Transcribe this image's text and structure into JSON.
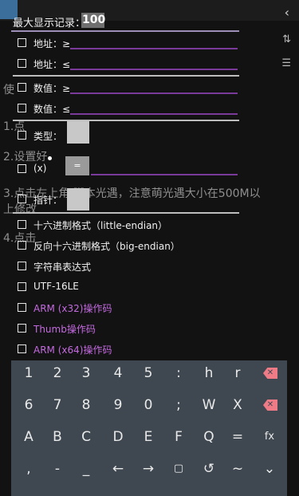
{
  "background": {
    "lines": [
      "使",
      "1.点",
      "2.设置好",
      "3.点击左上角 脚本光遇，注意萌光遇大小在500M以",
      "上修改",
      "4.点击 "
    ],
    "back_glyph": "‹",
    "side_glyphs": [
      "⇅",
      "☰"
    ]
  },
  "dialog": {
    "max_records_label": "最大显示记录：",
    "max_records_value": "100",
    "rows": [
      {
        "label": "地址：≥"
      },
      {
        "label": "地址：≤"
      },
      {
        "label": "数值：≥"
      },
      {
        "label": "数值：≤"
      },
      {
        "label": "类型："
      },
      {
        "label": "(x)"
      },
      {
        "label": "指针："
      },
      {
        "label": "十六进制格式（little-endian）"
      },
      {
        "label": "反向十六进制格式（big-endian）"
      },
      {
        "label": "字符串表达式"
      },
      {
        "label": "UTF-16LE"
      },
      {
        "label": "ARM (x32)操作码"
      },
      {
        "label": "Thumb操作码"
      },
      {
        "label": "ARM (x64)操作码"
      }
    ],
    "x_button": "="
  },
  "keyboard": {
    "row1": [
      "1",
      "2",
      "3",
      "4",
      "5",
      ":",
      "h",
      "r"
    ],
    "row2": [
      "6",
      "7",
      "8",
      "9",
      "0",
      ";",
      "W",
      "X"
    ],
    "row3": [
      "A",
      "B",
      "C",
      "D",
      "E",
      "F",
      "Q",
      "=",
      "fx"
    ],
    "row4": [
      ",",
      "-",
      "_",
      "←",
      "→",
      "▢",
      "↺",
      "~",
      "⌄"
    ],
    "del": "✕"
  },
  "colors": {
    "accent_purple": "#c46ae0",
    "field_line": "#7a3a9a",
    "keyboard_bg": "#3f4851",
    "delete_key": "#ef7b86"
  }
}
